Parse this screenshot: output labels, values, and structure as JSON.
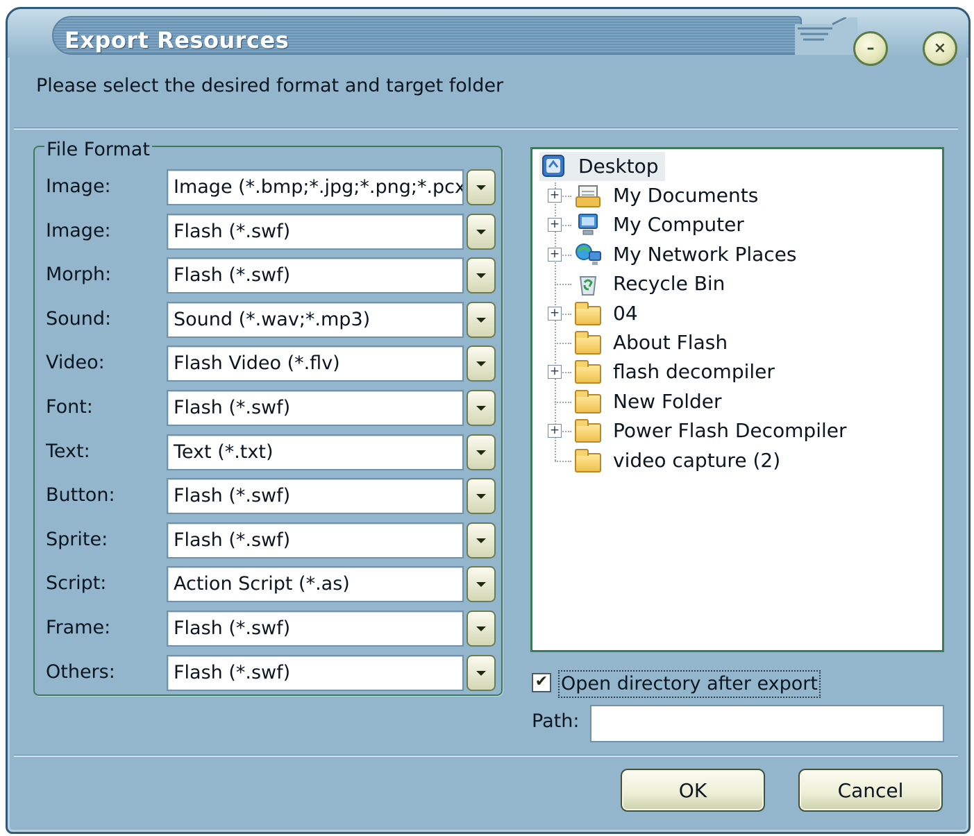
{
  "window": {
    "title": "Export Resources",
    "minimize_glyph": "–",
    "close_glyph": "×"
  },
  "subtitle": "Please select the desired format and target folder",
  "file_format": {
    "legend": "File Format",
    "rows": [
      {
        "label": "Image:",
        "value": "Image (*.bmp;*.jpg;*.png;*.pcx)"
      },
      {
        "label": "Image:",
        "value": "Flash (*.swf)"
      },
      {
        "label": "Morph:",
        "value": "Flash (*.swf)"
      },
      {
        "label": "Sound:",
        "value": "Sound (*.wav;*.mp3)"
      },
      {
        "label": "Video:",
        "value": "Flash Video (*.flv)"
      },
      {
        "label": "Font:",
        "value": "Flash (*.swf)"
      },
      {
        "label": "Text:",
        "value": "Text (*.txt)"
      },
      {
        "label": "Button:",
        "value": "Flash (*.swf)"
      },
      {
        "label": "Sprite:",
        "value": "Flash (*.swf)"
      },
      {
        "label": "Script:",
        "value": "Action Script (*.as)"
      },
      {
        "label": "Frame:",
        "value": "Flash (*.swf)"
      },
      {
        "label": "Others:",
        "value": "Flash (*.swf)"
      }
    ]
  },
  "folder_tree": {
    "root": {
      "label": "Desktop",
      "icon": "desktop-icon"
    },
    "items": [
      {
        "label": "My Documents",
        "icon": "my-documents-icon",
        "expandable": true
      },
      {
        "label": "My Computer",
        "icon": "my-computer-icon",
        "expandable": true
      },
      {
        "label": "My Network Places",
        "icon": "network-places-icon",
        "expandable": true
      },
      {
        "label": "Recycle Bin",
        "icon": "recycle-bin-icon",
        "expandable": false
      },
      {
        "label": "04",
        "icon": "folder-icon",
        "expandable": true
      },
      {
        "label": "About Flash",
        "icon": "folder-icon",
        "expandable": false
      },
      {
        "label": "flash decompiler",
        "icon": "folder-icon",
        "expandable": true
      },
      {
        "label": "New Folder",
        "icon": "folder-icon",
        "expandable": false
      },
      {
        "label": "Power Flash Decompiler",
        "icon": "folder-icon",
        "expandable": true
      },
      {
        "label": "video capture (2)",
        "icon": "folder-icon",
        "expandable": false
      }
    ]
  },
  "options": {
    "open_after_export_label": "Open directory after export",
    "open_after_export_checked": true,
    "check_glyph": "✔"
  },
  "path": {
    "label": "Path:",
    "value": ""
  },
  "buttons": {
    "ok": "OK",
    "cancel": "Cancel"
  },
  "tree_expander_glyph": "+",
  "colors": {
    "window_bg": "#93b6cc",
    "title_text": "#ffffff",
    "group_border": "#3d7a5c"
  }
}
